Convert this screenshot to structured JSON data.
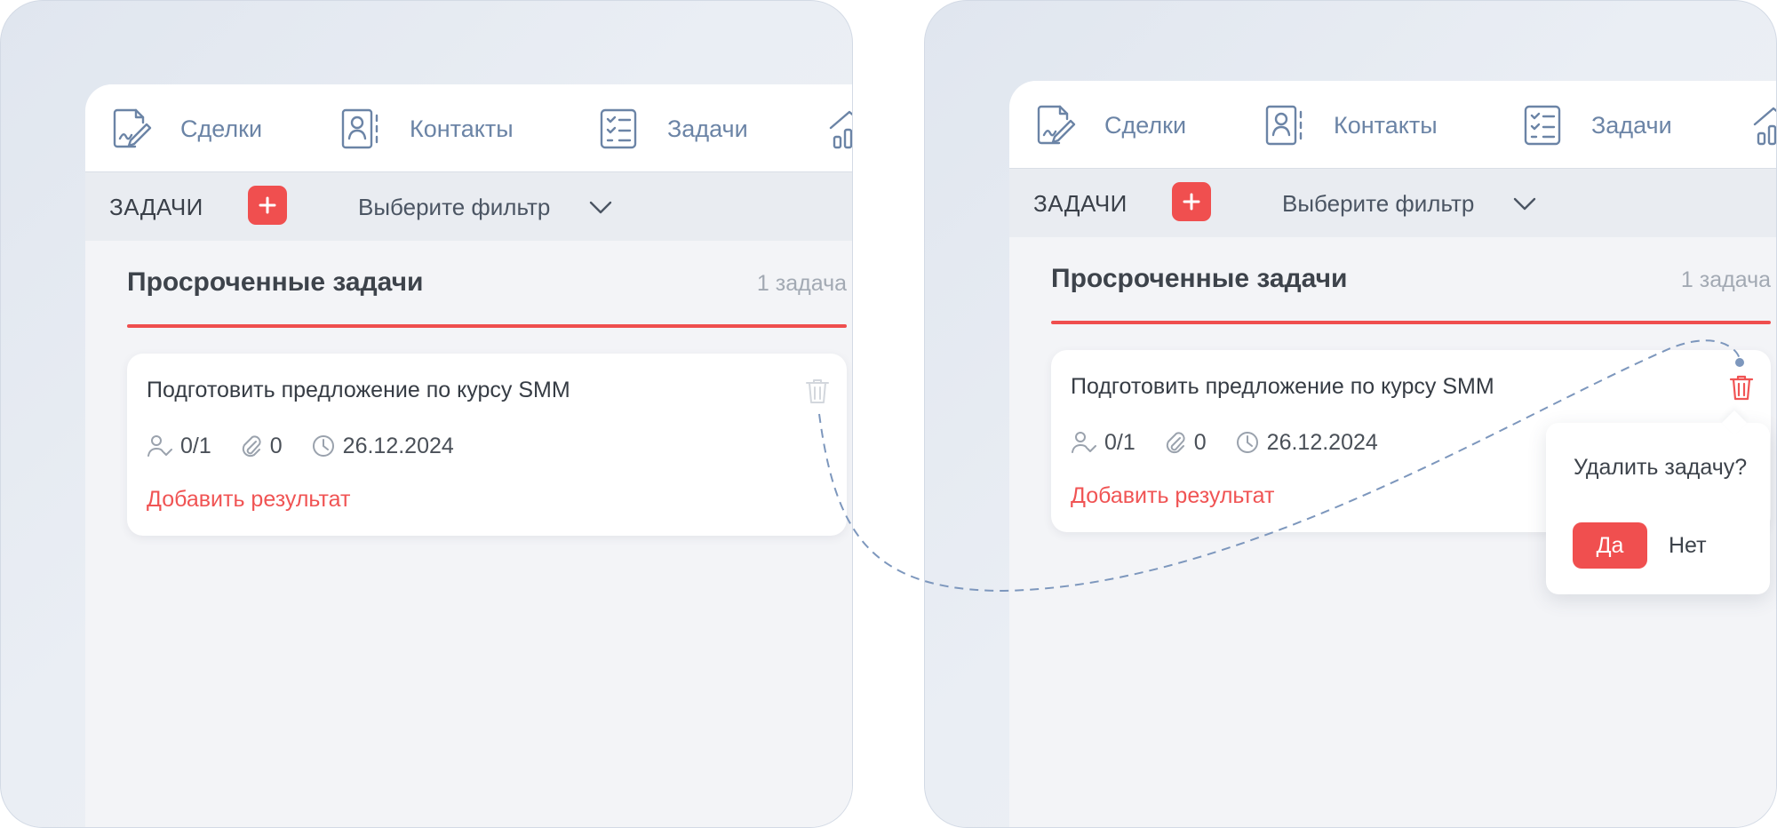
{
  "panels": [
    {
      "nav": [
        {
          "label": "Сделки",
          "icon": "deals-icon"
        },
        {
          "label": "Контакты",
          "icon": "contacts-icon"
        },
        {
          "label": "Задачи",
          "icon": "tasks-icon"
        },
        {
          "label": "",
          "icon": "analytics-icon"
        }
      ],
      "toolbar": {
        "title": "ЗАДАЧИ",
        "filter": "Выберите фильтр"
      },
      "section": {
        "title": "Просроченные задачи",
        "count": "1 задача"
      },
      "task": {
        "title": "Подготовить предложение по курсу SMM",
        "assignees": "0/1",
        "attachments": "0",
        "date": "26.12.2024",
        "result_link": "Добавить результат"
      }
    },
    {
      "nav": [
        {
          "label": "Сделки",
          "icon": "deals-icon"
        },
        {
          "label": "Контакты",
          "icon": "contacts-icon"
        },
        {
          "label": "Задачи",
          "icon": "tasks-icon"
        },
        {
          "label": "",
          "icon": "analytics-icon"
        }
      ],
      "toolbar": {
        "title": "ЗАДАЧИ",
        "filter": "Выберите фильтр"
      },
      "section": {
        "title": "Просроченные задачи",
        "count": "1 задача"
      },
      "task": {
        "title": "Подготовить предложение по курсу SMM",
        "assignees": "0/1",
        "attachments": "0",
        "date": "26.12.2024",
        "result_link": "Добавить результат"
      },
      "confirm": {
        "question": "Удалить задачу?",
        "yes": "Да",
        "no": "Нет"
      }
    }
  ],
  "colors": {
    "accent": "#f04f4f",
    "nav_text": "#6b84a6",
    "connector": "#7d97bd"
  }
}
